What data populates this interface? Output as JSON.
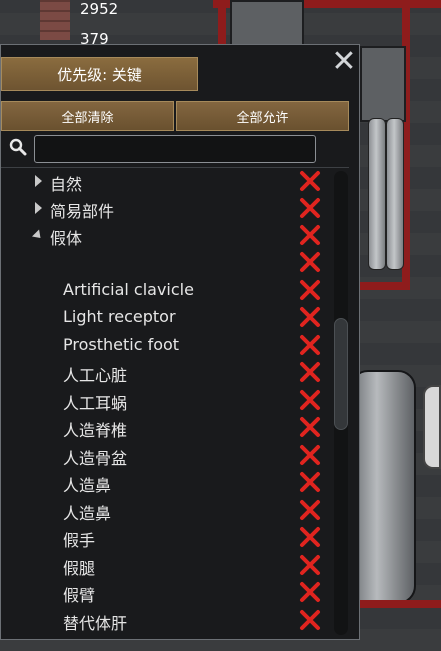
{
  "hud": {
    "count_top": "2952",
    "count_second": "379"
  },
  "window": {
    "close_icon": "close-icon",
    "priority_label": "优先级: 关键",
    "clear_all_label": "全部清除",
    "allow_all_label": "全部允许",
    "search": {
      "value": "",
      "placeholder": ""
    }
  },
  "tree": {
    "categories": [
      {
        "label": "自然",
        "expanded": false
      },
      {
        "label": "简易部件",
        "expanded": false
      },
      {
        "label": "假体",
        "expanded": true
      }
    ],
    "blank_row": "",
    "items": [
      "Artificial clavicle",
      "Light receptor",
      "Prosthetic foot",
      "人工心脏",
      "人工耳蜗",
      "人造脊椎",
      "人造骨盆",
      "人造鼻",
      "人造鼻",
      "假手",
      "假腿",
      "假臂",
      "替代体肝"
    ]
  },
  "colors": {
    "x_icon": "#e0241f",
    "button_bg": "#7b5f3a",
    "window_bg": "#191a1c"
  }
}
